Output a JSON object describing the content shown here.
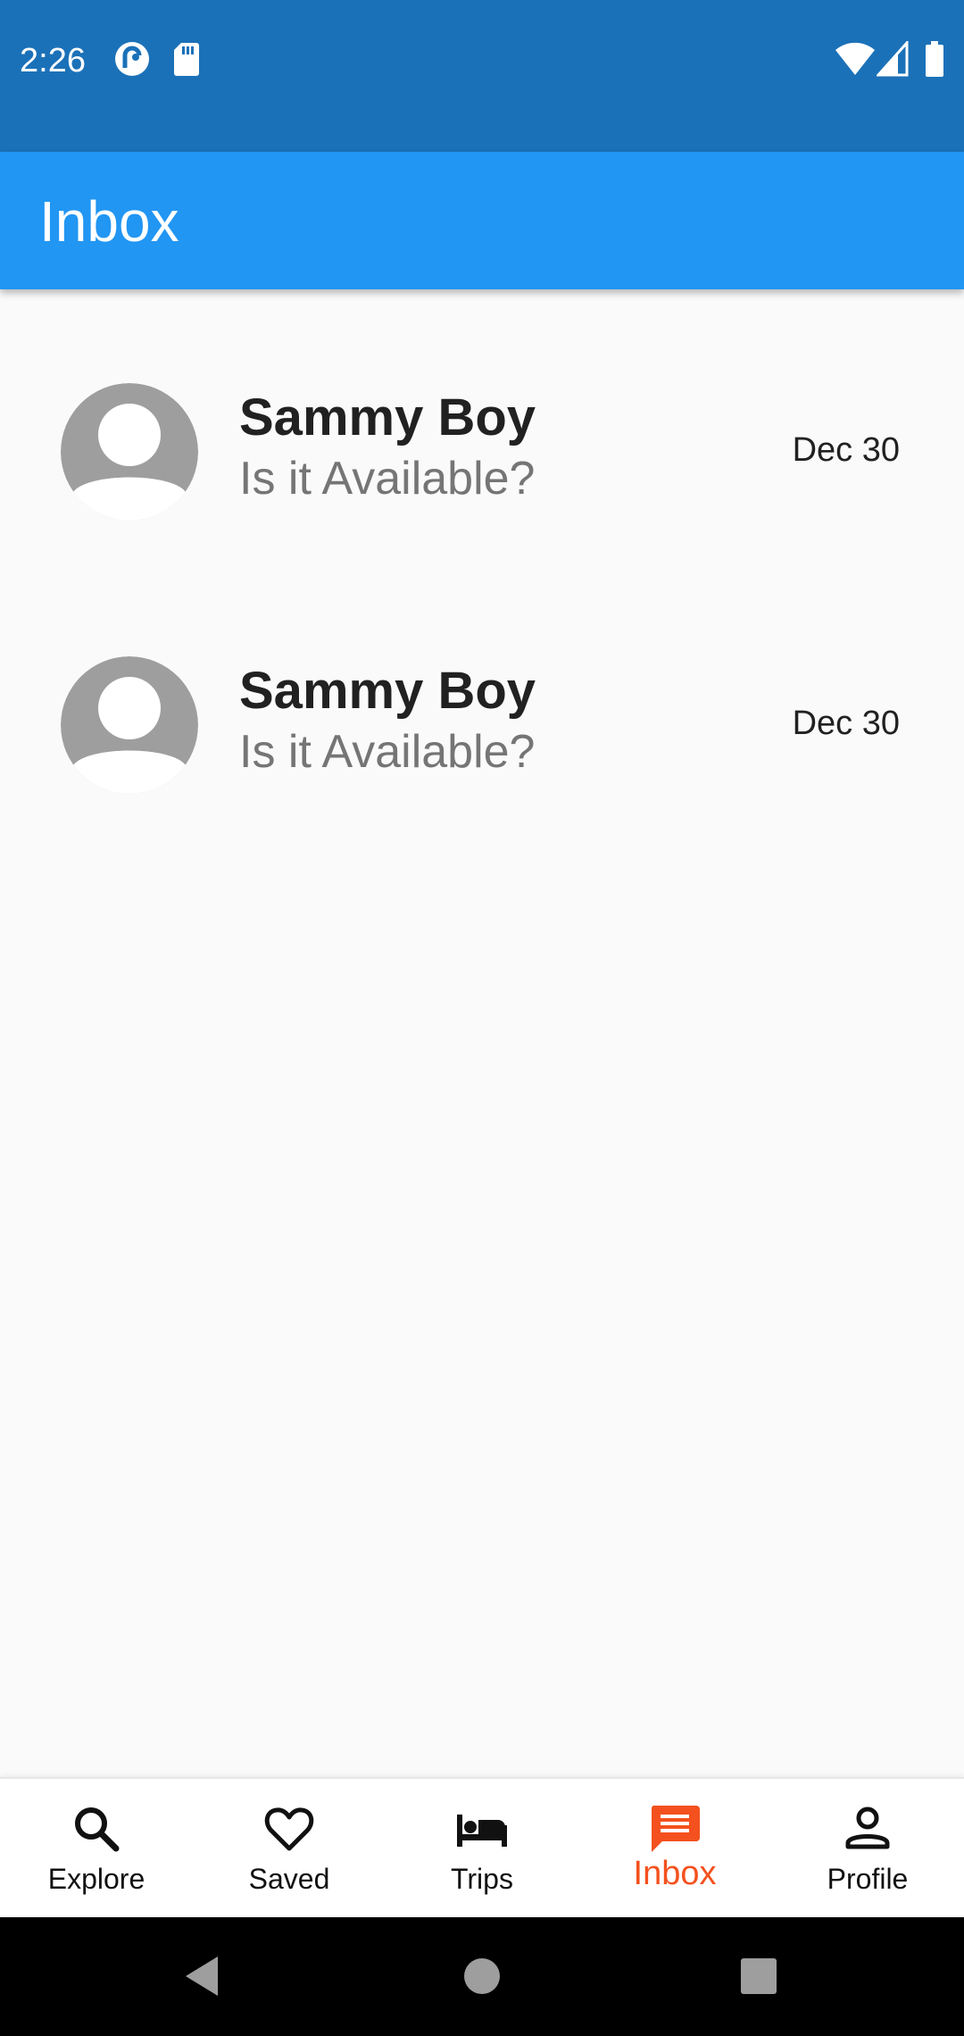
{
  "status_bar": {
    "time": "2:26",
    "left_icons": [
      "pocket-casts-icon",
      "sd-card-icon"
    ],
    "right_icons": [
      "wifi-icon",
      "cell-signal-icon",
      "battery-icon"
    ]
  },
  "app_bar": {
    "title": "Inbox"
  },
  "messages": [
    {
      "sender": "Sammy Boy",
      "preview": "Is it Available?",
      "date": "Dec 30",
      "avatar_icon": "default-avatar-icon"
    },
    {
      "sender": "Sammy Boy",
      "preview": "Is it Available?",
      "date": "Dec 30",
      "avatar_icon": "default-avatar-icon"
    }
  ],
  "bottom_nav": {
    "items": [
      {
        "label": "Explore",
        "icon": "search-icon",
        "active": false
      },
      {
        "label": "Saved",
        "icon": "heart-icon",
        "active": false
      },
      {
        "label": "Trips",
        "icon": "bed-icon",
        "active": false
      },
      {
        "label": "Inbox",
        "icon": "message-icon",
        "active": true
      },
      {
        "label": "Profile",
        "icon": "person-icon",
        "active": false
      }
    ],
    "active_color": "#f4511e"
  },
  "system_nav": {
    "buttons": [
      "back-icon",
      "home-icon",
      "recents-icon"
    ]
  },
  "colors": {
    "status_bar": "#1b71b8",
    "app_bar": "#2196f3",
    "background": "#fafafa",
    "avatar": "#9e9e9e"
  }
}
